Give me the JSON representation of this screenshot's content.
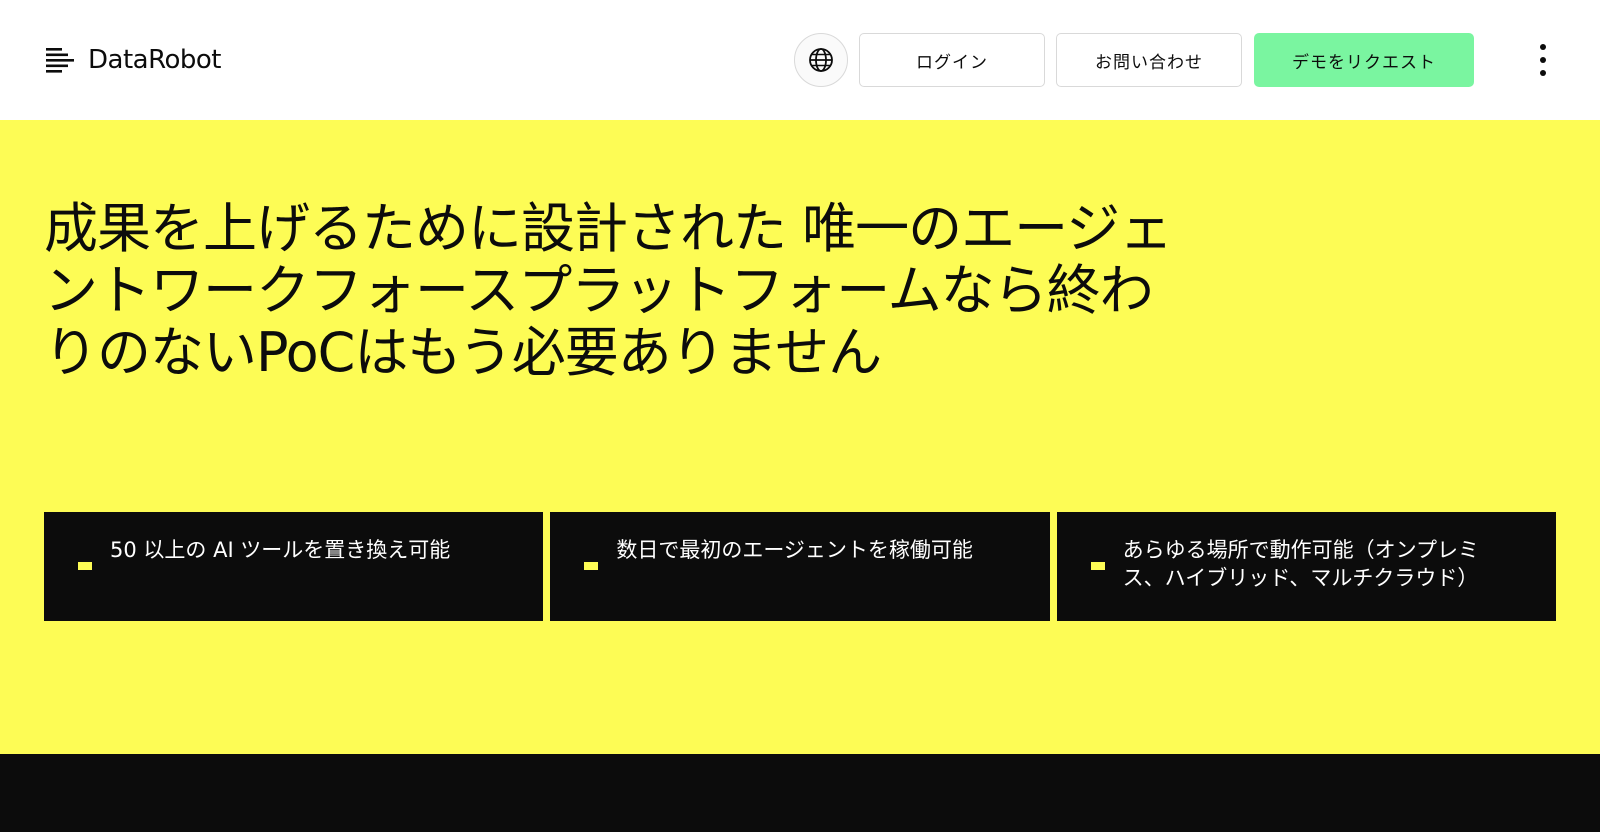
{
  "header": {
    "logo_text": "DataRobot",
    "globe_icon": "globe-icon",
    "login_label": "ログイン",
    "contact_label": "お問い合わせ",
    "demo_label": "デモをリクエスト",
    "menu_icon": "kebab-menu-icon"
  },
  "hero": {
    "title": "成果を上げるために設計された 唯一のエージェントワークフォースプラットフォームなら終わりのないPoCはもう必要ありません",
    "features": [
      {
        "text": "50 以上の AI ツールを置き換え可能"
      },
      {
        "text": "数日で最初のエージェントを稼働可能"
      },
      {
        "text": "あらゆる場所で動作可能（オンプレミス、ハイブリッド、マルチクラウド）"
      }
    ]
  },
  "colors": {
    "hero_background": "#fdfc55",
    "dark": "#0c0c0c",
    "demo_button": "#7af5a0",
    "bullet_accent": "#fdfc55"
  }
}
